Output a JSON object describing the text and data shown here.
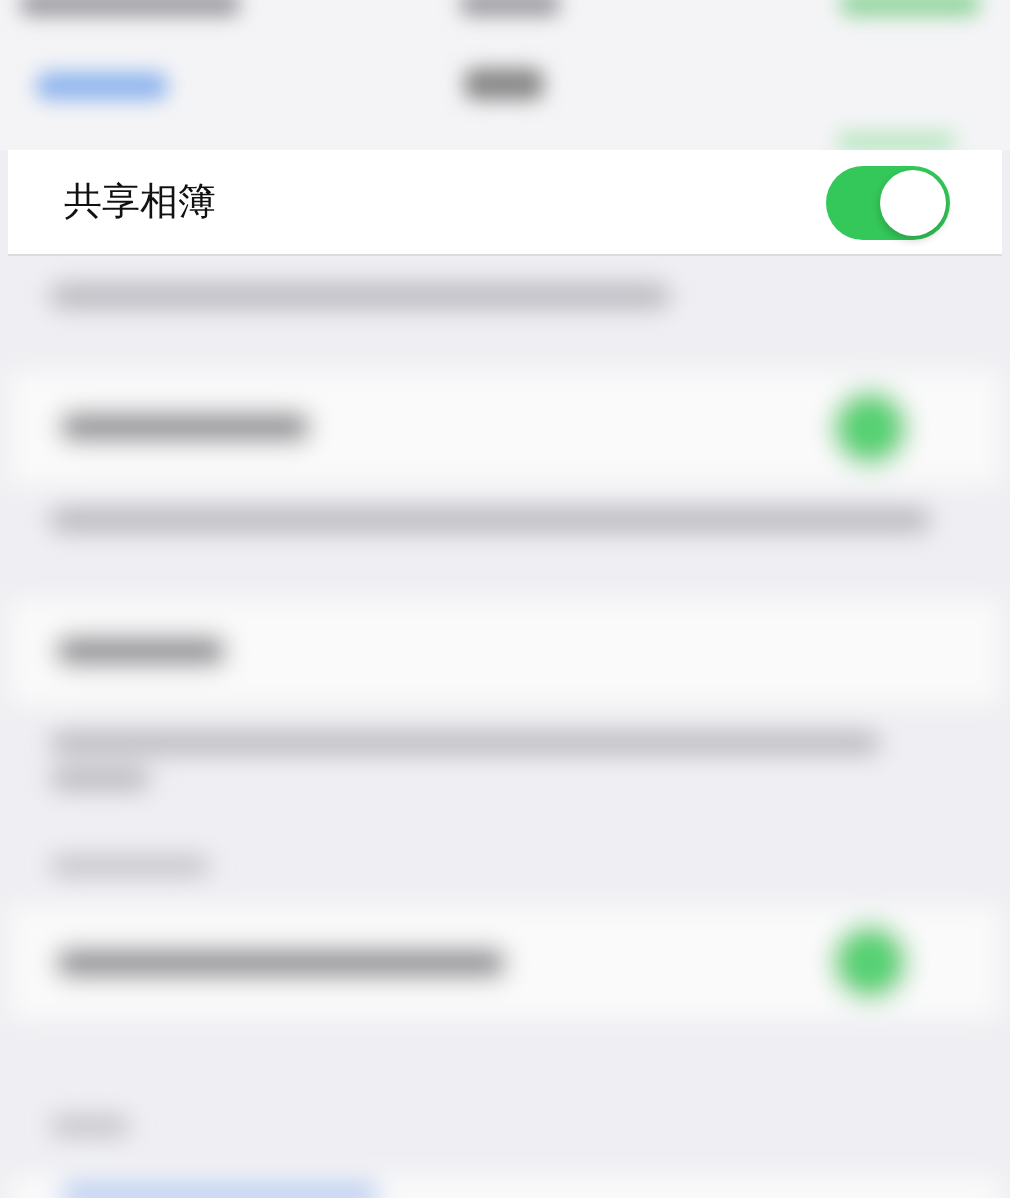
{
  "setting_row": {
    "label": "共享相簿",
    "on": true
  }
}
